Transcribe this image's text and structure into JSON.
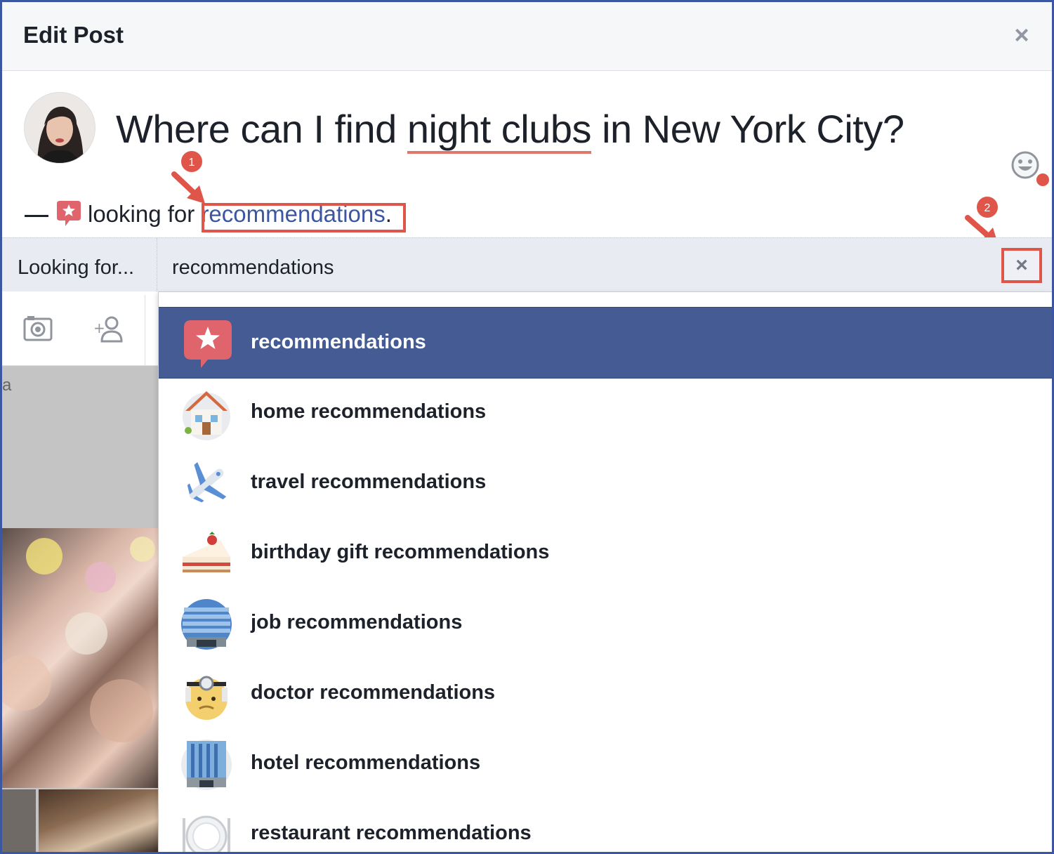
{
  "dialog": {
    "title": "Edit Post",
    "close_symbol": "×"
  },
  "post": {
    "text_before": "Where can I find ",
    "text_misspelled": "night clubs",
    "text_after": " in New York City?",
    "feeling_prefix": "looking for ",
    "feeling_link": "recommendations",
    "feeling_suffix": ".",
    "emoji_button_icon": "smiley-face-icon",
    "avatar_icon": "user-avatar"
  },
  "annotations": {
    "badge_1": "1",
    "badge_2": "2",
    "highlight_color": "#e0554a"
  },
  "activity_bar": {
    "label": "Looking for...",
    "value": "recommendations",
    "close_symbol": "×"
  },
  "tools": [
    {
      "icon": "camera-icon"
    },
    {
      "icon": "tag-people-icon"
    }
  ],
  "dropdown": {
    "items": [
      {
        "label": "recommendations",
        "icon": "star-speech-bubble-icon",
        "selected": true
      },
      {
        "label": "home recommendations",
        "icon": "house-icon",
        "selected": false
      },
      {
        "label": "travel recommendations",
        "icon": "airplane-icon",
        "selected": false
      },
      {
        "label": "birthday gift recommendations",
        "icon": "cake-icon",
        "selected": false
      },
      {
        "label": "job recommendations",
        "icon": "office-building-icon",
        "selected": false
      },
      {
        "label": "doctor recommendations",
        "icon": "doctor-icon",
        "selected": false
      },
      {
        "label": "hotel recommendations",
        "icon": "hotel-icon",
        "selected": false
      },
      {
        "label": "restaurant recommendations",
        "icon": "plate-fork-knife-icon",
        "selected": false
      }
    ]
  },
  "colors": {
    "brand_blue": "#3b57a1",
    "selected_row": "#455b93",
    "annotation_red": "#e0554a"
  }
}
